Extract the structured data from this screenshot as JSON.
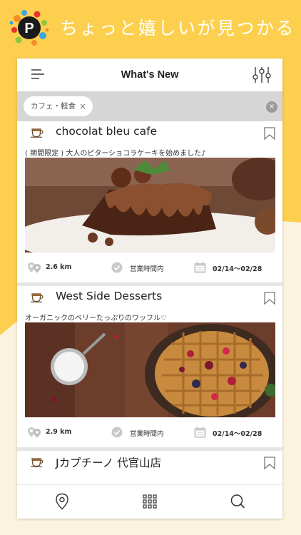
{
  "app": {
    "tagline": "ちょっと嬉しいが見つかる",
    "logo_letter": "P"
  },
  "panel": {
    "title": "What's New"
  },
  "filter": {
    "chip_label": "カフェ・軽食",
    "chip_remove": "×",
    "clear_all": "×"
  },
  "cards": [
    {
      "name": "chocolat bleu cafe",
      "caption": "( 期間限定 ) 大人のビターショコラケーキを始めました♪",
      "distance": "2.6 km",
      "status": "営業時間内",
      "period": "02/14〜02/28",
      "image": "chocolate-cake-photo"
    },
    {
      "name": "West Side Desserts",
      "caption": "オーガニックのベリーたっぷりのワッフル♡",
      "distance": "2.9 km",
      "status": "営業時間内",
      "period": "02/14〜02/28",
      "image": "berry-waffle-photo"
    },
    {
      "name": "Jカプチーノ 代官山店"
    }
  ],
  "nav": {
    "items": [
      "map-pin-icon",
      "grid-icon",
      "search-icon"
    ]
  },
  "colors": {
    "background_yellow": "#fcd04e",
    "background_cream": "#fbf3dd",
    "filter_bar": "#d6d6d6",
    "text_dark": "#222222"
  }
}
